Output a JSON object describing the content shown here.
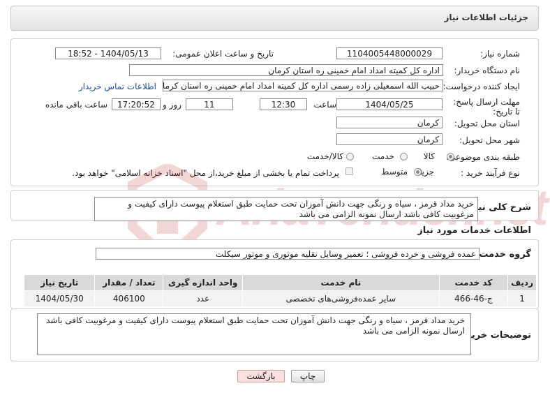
{
  "header": {
    "title": "جزئیات اطلاعات نیاز"
  },
  "form": {
    "need_number_label": "شماره نیاز:",
    "need_number": "1104005448000029",
    "announce_label": "تاریخ و ساعت اعلان عمومی:",
    "announce_value": "1404/05/13 - 18:52",
    "buyer_org_label": "نام دستگاه خریدار:",
    "buyer_org": "اداره کل کمیته امداد امام خمینی  ره  استان کرمان",
    "creator_label": "ایجاد کننده درخواست:",
    "creator": "حبیب الله اسمعیلی زاده رسمی  اداره کل کمیته امداد امام خمینی  ره  استان کرمان",
    "contact_link": "اطلاعات تماس خریدار",
    "deadline_label": "مهلت ارسال پاسخ: تا تاریخ:",
    "deadline_date": "1404/05/25",
    "time_label": "ساعت",
    "deadline_time": "12:30",
    "days": "11",
    "days_label": "روز و",
    "remaining_time": "17:20:52",
    "remaining_label": "ساعت باقی مانده",
    "province_label": "استان محل تحویل:",
    "province": "کرمان",
    "city_label": "شهر محل تحویل:",
    "city": "کرمان",
    "category_label": "طبقه بندی موضوعی:",
    "category_options": [
      "کالا",
      "خدمت",
      "کالا/خدمت"
    ],
    "category_selected": "کالا",
    "process_label": "نوع فرآیند خرید :",
    "process_options": [
      "جزیی",
      "متوسط"
    ],
    "process_selected": "جزیی",
    "payment_note": "پرداخت تمام یا بخشی از مبلغ خرید،از محل \"اسناد خزانه اسلامی\" خواهد بود."
  },
  "summary": {
    "label": "شرح کلی نیاز:",
    "text": "خرید مداد قرمز ، سیاه و رنگی  جهت دانش آموزان تحت حمایت طبق استعلام پیوست دارای کیفیت و مرغوبیت کافی باشد ارسال نمونه الزامی می باشد"
  },
  "services": {
    "section_title": "اطلاعات خدمات مورد نیاز",
    "group_label": "گروه خدمت:",
    "group_value": "عمده فروشی و خرده فروشی ؛ تعمیر وسایل نقلیه موتوری و موتور سیکلت",
    "columns": [
      "ردیف",
      "کد خدمت",
      "نام خدمت",
      "واحد اندازه گیری",
      "تعداد / مقدار",
      "تاریخ نیاز"
    ],
    "rows": [
      {
        "row": "1",
        "code": "ج-46-466",
        "name": "سایر عمده‌فروشی‌های تخصصی",
        "unit": "عدد",
        "qty": "406100",
        "date": "1404/05/30"
      }
    ]
  },
  "buyer_notes": {
    "label": "توضیحات خریدار:",
    "text": "خرید مداد قرمز ، سیاه و رنگی  جهت دانش آموزان تحت حمایت طبق استعلام پیوست دارای کیفیت و مرغوبیت کافی باشد ارسال نمونه الزامی می باشد"
  },
  "buttons": {
    "print": "چاپ",
    "back": "بازگشت"
  },
  "watermark": {
    "text": "AriaTender.net"
  },
  "colors": {
    "link": "#1a4fa0",
    "back_button": "#fde0e0",
    "header_bg": "#e4e4e4",
    "watermark": "#b22222"
  }
}
